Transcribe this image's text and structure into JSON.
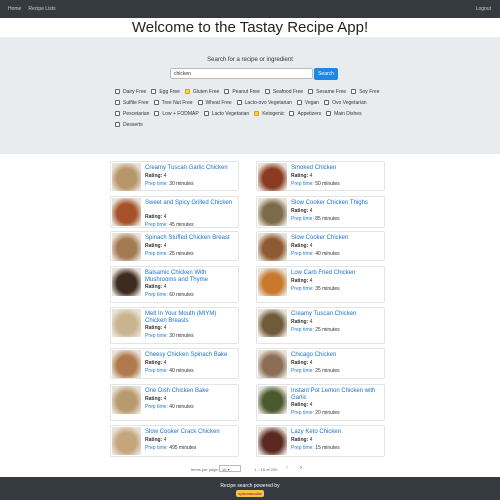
{
  "nav": {
    "home": "Home",
    "recipe_lists": "Recipe Lists",
    "logout": "Logout"
  },
  "header": {
    "title": "Welcome to the Tastay Recipe App!"
  },
  "search": {
    "label": "Search for a recipe or ingredient",
    "value": "chicken",
    "button": "Search"
  },
  "filters": [
    [
      {
        "label": "Dairy Free",
        "checked": false
      },
      {
        "label": "Egg Free",
        "checked": false
      },
      {
        "label": "Gluten Free",
        "checked": true
      },
      {
        "label": "Peanut Free",
        "checked": false
      },
      {
        "label": "Seafood Free",
        "checked": false
      },
      {
        "label": "Sesame Free",
        "checked": false
      },
      {
        "label": "Soy Free",
        "checked": false
      }
    ],
    [
      {
        "label": "Sulfite Free",
        "checked": false
      },
      {
        "label": "Tree Nut Free",
        "checked": false
      },
      {
        "label": "Wheat Free",
        "checked": false
      },
      {
        "label": "Lacto-ovo Vegetarian",
        "checked": false
      },
      {
        "label": "Vegan",
        "checked": false
      },
      {
        "label": "Ovo Vegetarian",
        "checked": false
      }
    ],
    [
      {
        "label": "Pescetarian",
        "checked": false
      },
      {
        "label": "Low + FODMAP",
        "checked": false
      },
      {
        "label": "Lacto Vegetarian",
        "checked": false
      },
      {
        "label": "Ketogenic",
        "checked": true
      },
      {
        "label": "Appetizers",
        "checked": false
      },
      {
        "label": "Main Dishes",
        "checked": false
      }
    ],
    [
      {
        "label": "Desserts",
        "checked": false
      }
    ]
  ],
  "recipes": [
    {
      "title": "Creamy Tuscan Garlic Chicken",
      "rating_label": "Rating:",
      "rating": "4",
      "prep_label": "Prep time:",
      "prep": "30 minutes",
      "color": "#b8956a"
    },
    {
      "title": "Smoked Chicken",
      "rating_label": "Rating:",
      "rating": "4",
      "prep_label": "Prep time:",
      "prep": "50 minutes",
      "color": "#8a3b22"
    },
    {
      "title": "Sweet and Spicy Grilled Chicken",
      "rating_label": "Rating:",
      "rating": "4",
      "prep_label": "Prep time:",
      "prep": "45 minutes",
      "color": "#a5522a"
    },
    {
      "title": "Slow Cooker Chicken Thighs",
      "rating_label": "Rating:",
      "rating": "4",
      "prep_label": "Prep time:",
      "prep": "85 minutes",
      "color": "#7d6a4a"
    },
    {
      "title": "Spinach Stuffed Chicken Breast",
      "rating_label": "Rating:",
      "rating": "4",
      "prep_label": "Prep time:",
      "prep": "25 minutes",
      "color": "#a47a52"
    },
    {
      "title": "Slow Cooker Chicken",
      "rating_label": "Rating:",
      "rating": "4",
      "prep_label": "Prep time:",
      "prep": "40 minutes",
      "color": "#8e5a33"
    },
    {
      "title": "Balsamic Chicken With Mushrooms and Thyme",
      "rating_label": "Rating:",
      "rating": "4",
      "prep_label": "Prep time:",
      "prep": "60 minutes",
      "color": "#3e2b1f"
    },
    {
      "title": "Low Carb Fried Chicken",
      "rating_label": "Rating:",
      "rating": "4",
      "prep_label": "Prep time:",
      "prep": "35 minutes",
      "color": "#c9782e"
    },
    {
      "title": "Melt In Your Mouth (MIYM) Chicken Breasts",
      "rating_label": "Rating:",
      "rating": "4",
      "prep_label": "Prep time:",
      "prep": "30 minutes",
      "color": "#c8b48e"
    },
    {
      "title": "Creamy Tuscan Chicken",
      "rating_label": "Rating:",
      "rating": "4",
      "prep_label": "Prep time:",
      "prep": "25 minutes",
      "color": "#6f5a3a"
    },
    {
      "title": "Cheesy Chicken Spinach Bake",
      "rating_label": "Rating:",
      "rating": "4",
      "prep_label": "Prep time:",
      "prep": "40 minutes",
      "color": "#b07a4c"
    },
    {
      "title": "Chicago Chicken",
      "rating_label": "Rating:",
      "rating": "4",
      "prep_label": "Prep time:",
      "prep": "25 minutes",
      "color": "#8b6e55"
    },
    {
      "title": "One Dish Chicken Bake",
      "rating_label": "Rating:",
      "rating": "4",
      "prep_label": "Prep time:",
      "prep": "40 minutes",
      "color": "#b79a6e"
    },
    {
      "title": "Instant Pot Lemon Chicken with Garlic",
      "rating_label": "Rating:",
      "rating": "4",
      "prep_label": "Prep time:",
      "prep": "20 minutes",
      "color": "#4a5a2e"
    },
    {
      "title": "Slow Cooker Crack Chicken",
      "rating_label": "Rating:",
      "rating": "4",
      "prep_label": "Prep time:",
      "prep": "495 minutes",
      "color": "#c4a57c"
    },
    {
      "title": "Lazy Keto Chicken",
      "rating_label": "Rating:",
      "rating": "4",
      "prep_label": "Prep time:",
      "prep": "15 minutes",
      "color": "#5a2a22"
    }
  ],
  "pager": {
    "items_per_page_label": "Items per page:",
    "items_per_page": "16",
    "range": "1 – 16 of 200",
    "prev": "‹",
    "next": "›"
  },
  "footer": {
    "note": "Recipe search powered by",
    "logo_text": "spoonacular"
  }
}
